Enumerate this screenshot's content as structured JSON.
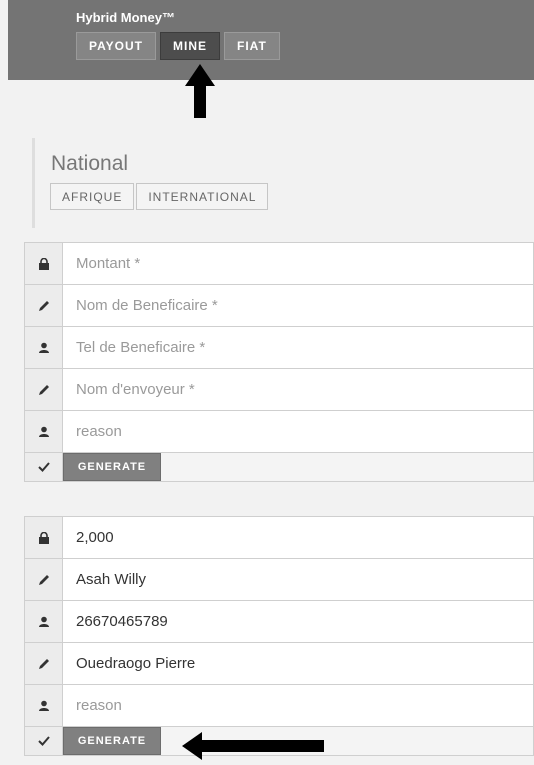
{
  "header": {
    "brand": "Hybrid Money™",
    "tabs": [
      "PAYOUT",
      "MINE",
      "FIAT"
    ],
    "active_tab": "MINE"
  },
  "section": {
    "title": "National",
    "tabs": [
      "AFRIQUE",
      "INTERNATIONAL"
    ]
  },
  "form1": {
    "amount_placeholder": "Montant *",
    "beneficiary_name_placeholder": "Nom de Beneficaire *",
    "beneficiary_phone_placeholder": "Tel de Beneficaire *",
    "sender_name_placeholder": "Nom d'envoyeur *",
    "reason_placeholder": "reason",
    "generate_label": "GENERATE"
  },
  "form2": {
    "amount": "2,000",
    "beneficiary_name": "Asah Willy",
    "beneficiary_phone": "26670465789",
    "sender_name": "Ouedraogo Pierre",
    "reason_placeholder": "reason",
    "generate_label": "GENERATE"
  },
  "icons": {
    "lock": "lock-icon",
    "pencil": "pencil-icon",
    "user": "user-icon",
    "check": "check-icon",
    "arrow_up": "arrow-up-icon",
    "arrow_left": "arrow-left-icon"
  },
  "colors": {
    "topbar": "#747474",
    "active_tab": "#4d4d4d",
    "button": "#808080"
  }
}
